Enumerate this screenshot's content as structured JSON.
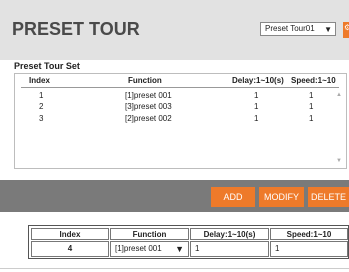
{
  "header": {
    "title": "PRESET TOUR",
    "tour_select": "Preset Tour01"
  },
  "preset_set": {
    "title": "Preset Tour Set",
    "columns": [
      "Index",
      "Function",
      "Delay:1~10(s)",
      "Speed:1~10"
    ],
    "rows": [
      {
        "index": "1",
        "function": "[1]preset 001",
        "delay": "1",
        "speed": "1"
      },
      {
        "index": "2",
        "function": "[3]preset 003",
        "delay": "1",
        "speed": "1"
      },
      {
        "index": "3",
        "function": "[2]preset 002",
        "delay": "1",
        "speed": "1"
      }
    ]
  },
  "buttons": {
    "add": "ADD",
    "modify": "MODIFY",
    "delete": "DELETE"
  },
  "edit": {
    "columns": [
      "Index",
      "Function",
      "Delay:1~10(s)",
      "Speed:1~10"
    ],
    "index": "4",
    "function": "[1]preset 001",
    "delay": "1",
    "speed": "1"
  },
  "colors": {
    "accent": "#ee7a2a",
    "header_bg": "#e2e2e2",
    "band_bg": "#7a7a7a"
  }
}
